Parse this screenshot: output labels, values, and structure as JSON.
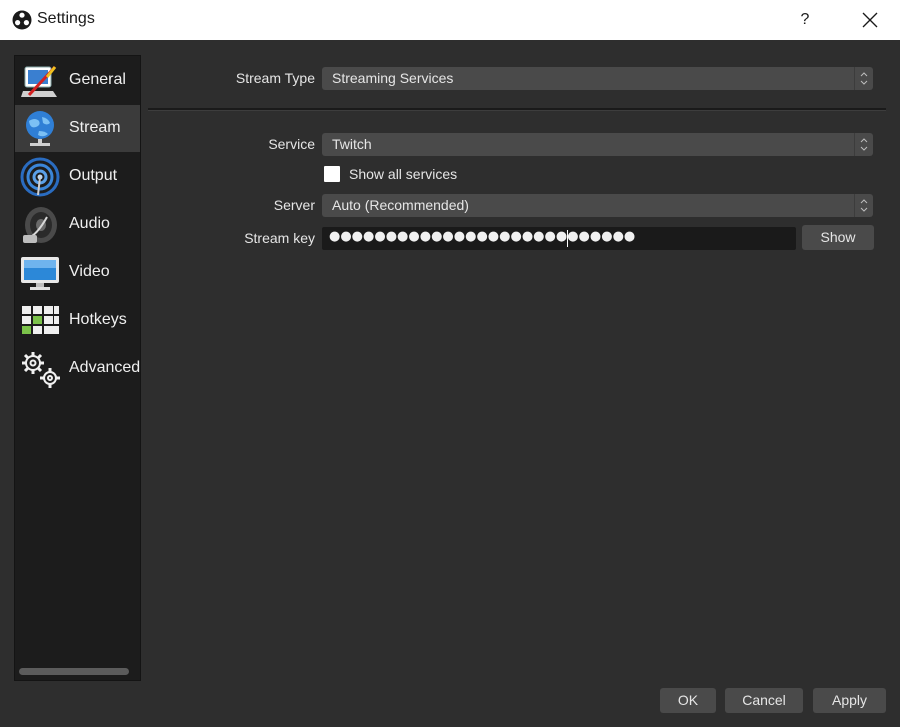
{
  "window": {
    "title": "Settings",
    "help_label": "?"
  },
  "sidebar": {
    "items": [
      {
        "label": "General",
        "icon": "general-icon",
        "active": false
      },
      {
        "label": "Stream",
        "icon": "globe-icon",
        "active": true
      },
      {
        "label": "Output",
        "icon": "broadcast-icon",
        "active": false
      },
      {
        "label": "Audio",
        "icon": "speaker-icon",
        "active": false
      },
      {
        "label": "Video",
        "icon": "monitor-icon",
        "active": false
      },
      {
        "label": "Hotkeys",
        "icon": "keyboard-icon",
        "active": false
      },
      {
        "label": "Advanced",
        "icon": "gears-icon",
        "active": false
      }
    ]
  },
  "stream": {
    "stream_type_label": "Stream Type",
    "stream_type_value": "Streaming Services",
    "service_label": "Service",
    "service_value": "Twitch",
    "show_all_label": "Show all services",
    "show_all_checked": false,
    "server_label": "Server",
    "server_value": "Auto (Recommended)",
    "stream_key_label": "Stream key",
    "stream_key_value": "●●●●●●●●●●●●●●●●●●●●●●●●●●●",
    "show_button": "Show"
  },
  "footer": {
    "ok": "OK",
    "cancel": "Cancel",
    "apply": "Apply"
  },
  "colors": {
    "background": "#2e2e2e",
    "sidebar": "#1c1c1c",
    "sidebar_active": "#3b3b3b",
    "control": "#4a4a4a",
    "titlebar": "#ffffff"
  }
}
